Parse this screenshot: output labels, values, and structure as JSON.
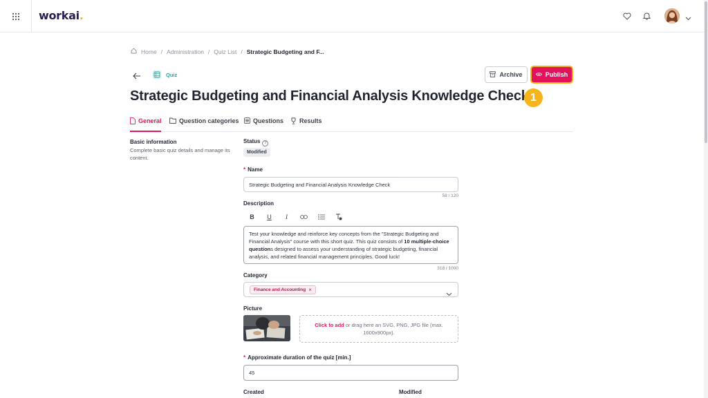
{
  "app": {
    "logo": "workai",
    "logo_dot": "."
  },
  "breadcrumb": {
    "home": "Home",
    "administration": "Administration",
    "quiz_list": "Quiz List",
    "current": "Strategic Budgeting and F...",
    "separator": "/"
  },
  "header": {
    "chip_label": "Quiz",
    "archive_label": "Archive",
    "publish_label": "Publish",
    "title": "Strategic Budgeting and Financial Analysis Knowledge Check",
    "step_number": "1"
  },
  "tabs": [
    {
      "label": "General",
      "active": true,
      "icon": "file-icon"
    },
    {
      "label": "Question categories",
      "active": false,
      "icon": "folder-icon"
    },
    {
      "label": "Questions",
      "active": false,
      "icon": "list-icon"
    },
    {
      "label": "Results",
      "active": false,
      "icon": "trophy-icon"
    }
  ],
  "basic": {
    "title": "Basic information",
    "description": "Complete basic quiz details and manage its content."
  },
  "form": {
    "status_label": "Status",
    "status_value": "Modified",
    "required_mark": "*",
    "name_label": "Name",
    "name_value": "Strategic Budgeting and Financial Analysis Knowledge Check",
    "name_counter": "58 / 120",
    "description_label": "Description",
    "toolbar": {
      "bold": "B",
      "underline": "U",
      "italic": "I",
      "link": "link",
      "list": "list",
      "clear": "clear-format"
    },
    "description_part1": "Test your knowledge and reinforce key concepts from the \"Strategic Budgeting and Financial Analysis\" course with this short quiz. This quiz consists of ",
    "description_bold": "10 multiple-choice question",
    "description_part2": "s designed to assess your understanding of strategic budgeting, financial analysis, and related financial management principles. Good luck!",
    "description_counter": "318 / 1000",
    "category_label": "Category",
    "category_chip": "Finance and Accounting",
    "chip_remove": "×",
    "picture_label": "Picture",
    "dropzone_link": "Click to add",
    "dropzone_text": " or drag here an SVG, PNG, JPG file (max. 1600x900px).",
    "duration_label": "Approximate duration of the quiz [min.]",
    "duration_value": "45",
    "created_label": "Created",
    "modified_label": "Modified"
  },
  "colors": {
    "accent": "#e3135b",
    "highlight": "#f5b41c",
    "teal": "#2aa5a0"
  }
}
